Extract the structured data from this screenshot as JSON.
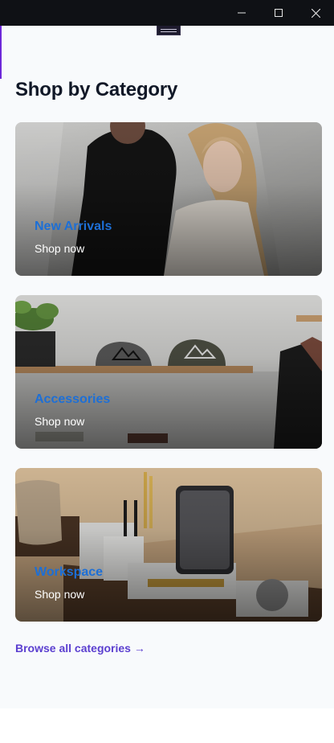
{
  "window": {
    "controls": {
      "minimize_icon": "minimize-icon",
      "maximize_icon": "maximize-icon",
      "close_icon": "close-icon"
    }
  },
  "page": {
    "title": "Shop by Category",
    "categories": [
      {
        "name": "New Arrivals",
        "cta": "Shop now"
      },
      {
        "name": "Accessories",
        "cta": "Shop now"
      },
      {
        "name": "Workspace",
        "cta": "Shop now"
      }
    ],
    "browse_link": "Browse all categories →"
  },
  "colors": {
    "accent_purple": "#5b3fd0",
    "category_link_blue": "#1d6fd6",
    "heading": "#111827",
    "background": "#f8fafc"
  }
}
